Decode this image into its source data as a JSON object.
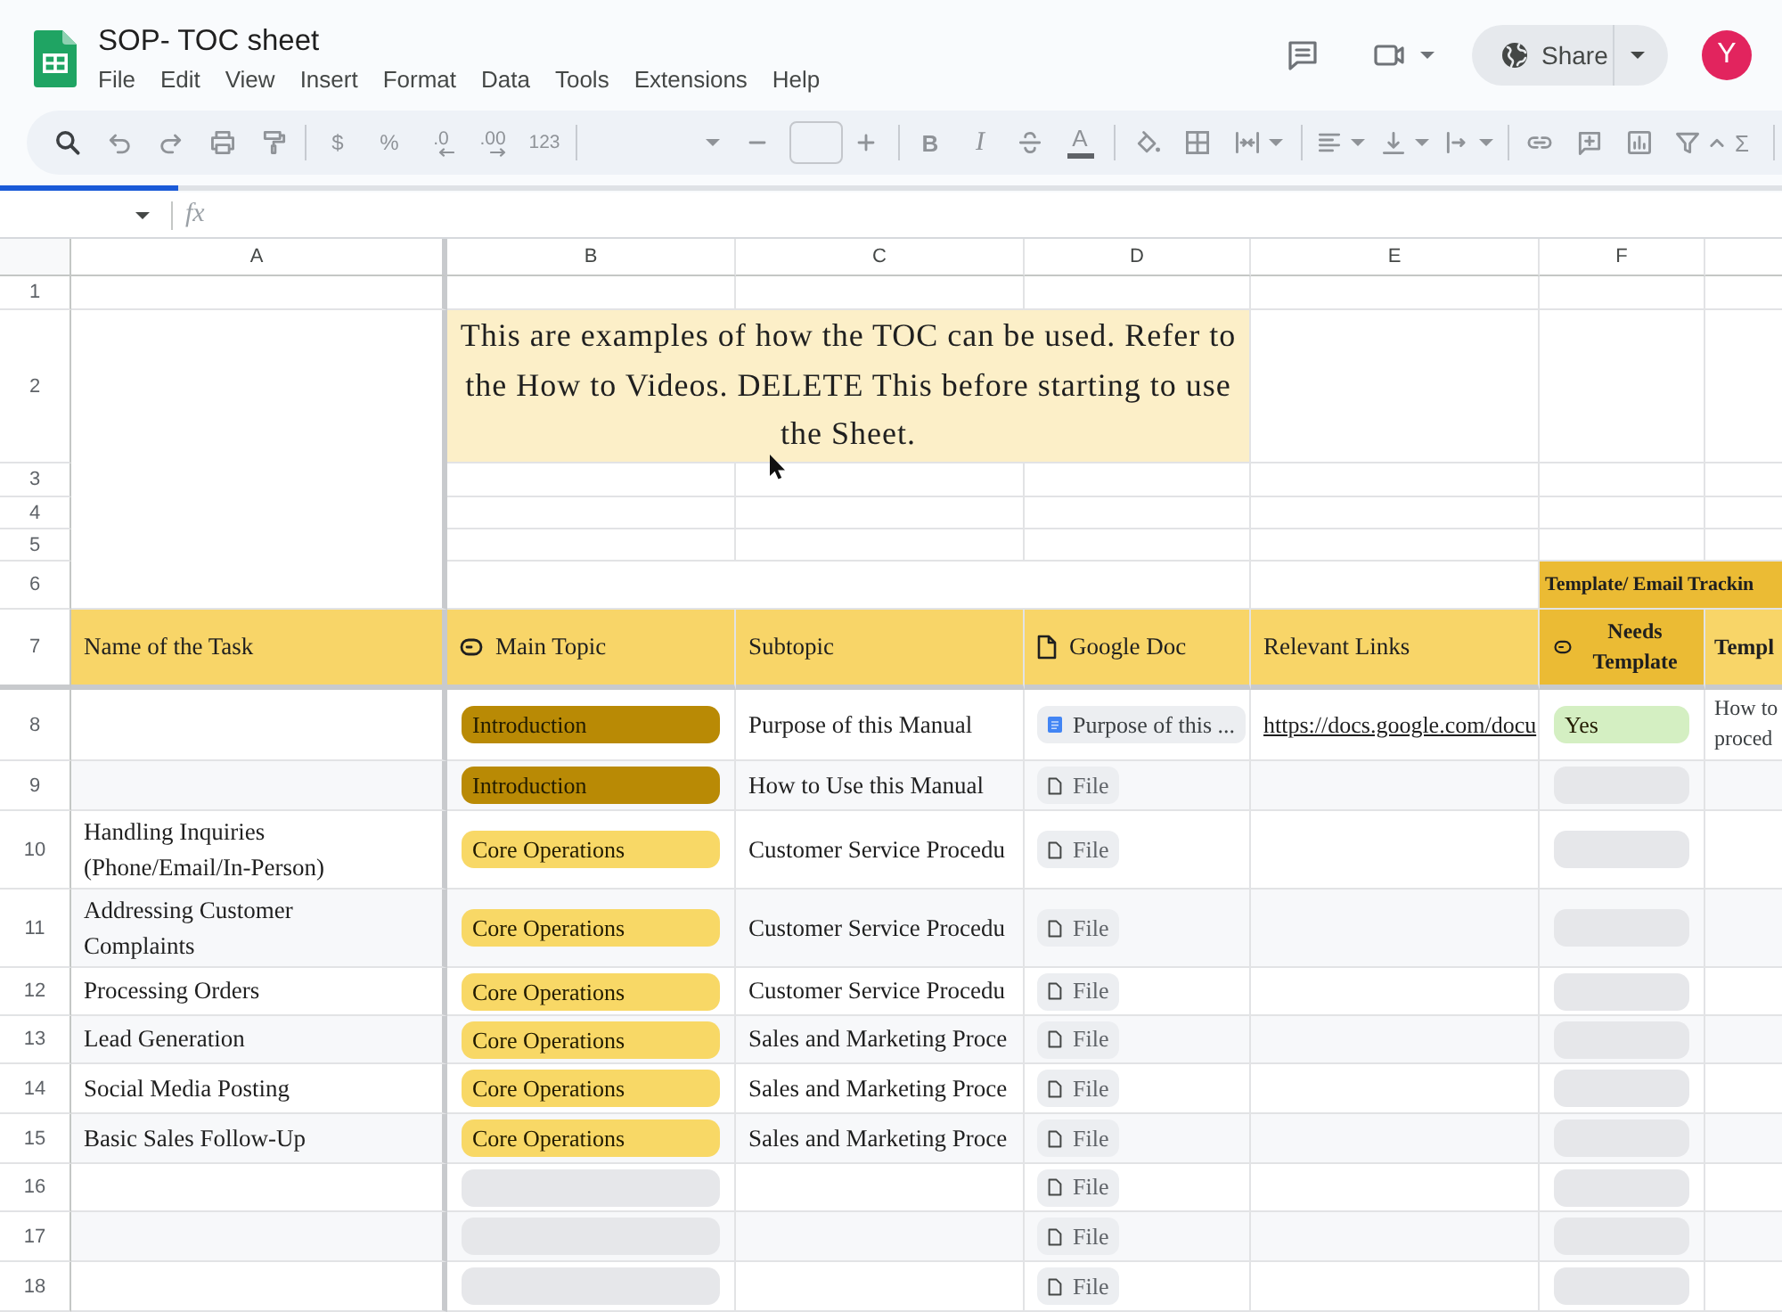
{
  "document": {
    "title": "SOP- TOC sheet"
  },
  "menu": [
    "File",
    "Edit",
    "View",
    "Insert",
    "Format",
    "Data",
    "Tools",
    "Extensions",
    "Help"
  ],
  "share": {
    "label": "Share"
  },
  "account": {
    "initial": "Y"
  },
  "toolbar": {
    "currency": "$",
    "percent": "%",
    "decrease_decimals": ".0",
    "increase_decimals": ".00",
    "number_format": "123",
    "bold": "B",
    "italic": "I",
    "text_color": "A",
    "functions": "Σ"
  },
  "loading": {
    "level": 0.1
  },
  "formula_bar": {
    "label": "fx"
  },
  "sheet": {
    "column_letters": [
      "A",
      "B",
      "C",
      "D",
      "E",
      "F"
    ],
    "frozen_row_numbers": [
      "1",
      "2",
      "3",
      "4",
      "5",
      "6",
      "7"
    ],
    "note": "This are examples of how the TOC can be used. Refer to the How to Videos. DELETE This before starting to use the Sheet.",
    "group_header": "Template/ Email Trackin",
    "columns": [
      {
        "label": "Name of the Task",
        "kind": "text"
      },
      {
        "label": "Main Topic",
        "kind": "chip"
      },
      {
        "label": "Subtopic",
        "kind": "text"
      },
      {
        "label": "Google Doc",
        "kind": "file"
      },
      {
        "label": "Relevant Links",
        "kind": "text"
      },
      {
        "label": "Needs Template",
        "kind": "chip"
      },
      {
        "label": "Templ",
        "kind": "text"
      }
    ],
    "rows": [
      {
        "number": "8",
        "main_topic": {
          "label": "Introduction",
          "color": "#b98a05"
        },
        "subtopic": "Purpose of this Manual",
        "google_doc": {
          "kind": "document",
          "label": "Purpose of this ..."
        },
        "relevant_link": "https://docs.google.com/docu",
        "needs_template": {
          "label": "Yes",
          "color": "#d4efc2"
        },
        "column_7": "How to proced"
      },
      {
        "number": "9",
        "main_topic": {
          "label": "Introduction",
          "color": "#b98a05"
        },
        "subtopic": "How to Use this Manual",
        "google_doc": {
          "kind": "file",
          "label": "File"
        },
        "needs_template": {
          "color": "#e6e7ea"
        }
      },
      {
        "number": "10",
        "task": "Handling Inquiries (Phone/Email/In-Person)",
        "main_topic": {
          "label": "Core Operations",
          "color": "#f8d866"
        },
        "subtopic": "Customer Service Procedu",
        "google_doc": {
          "kind": "file",
          "label": "File"
        },
        "needs_template": {
          "color": "#e6e7ea"
        }
      },
      {
        "number": "11",
        "task": "Addressing Customer Complaints",
        "main_topic": {
          "label": "Core Operations",
          "color": "#f8d866"
        },
        "subtopic": "Customer Service Procedu",
        "google_doc": {
          "kind": "file",
          "label": "File"
        },
        "needs_template": {
          "color": "#e6e7ea"
        }
      },
      {
        "number": "12",
        "task": "Processing Orders",
        "main_topic": {
          "label": "Core Operations",
          "color": "#f8d866"
        },
        "subtopic": "Customer Service Procedu",
        "google_doc": {
          "kind": "file",
          "label": "File"
        },
        "needs_template": {
          "color": "#e6e7ea"
        }
      },
      {
        "number": "13",
        "task": "Lead Generation",
        "main_topic": {
          "label": "Core Operations",
          "color": "#f8d866"
        },
        "subtopic": "Sales and Marketing Proce",
        "google_doc": {
          "kind": "file",
          "label": "File"
        },
        "needs_template": {
          "color": "#e6e7ea"
        }
      },
      {
        "number": "14",
        "task": "Social Media Posting",
        "main_topic": {
          "label": "Core Operations",
          "color": "#f8d866"
        },
        "subtopic": "Sales and Marketing Proce",
        "google_doc": {
          "kind": "file",
          "label": "File"
        },
        "needs_template": {
          "color": "#e6e7ea"
        }
      },
      {
        "number": "15",
        "task": "Basic Sales Follow-Up",
        "main_topic": {
          "label": "Core Operations",
          "color": "#f8d866"
        },
        "subtopic": "Sales and Marketing Proce",
        "google_doc": {
          "kind": "file",
          "label": "File"
        },
        "needs_template": {
          "color": "#e6e7ea"
        }
      },
      {
        "number": "16",
        "main_topic": {
          "color": "#e6e7ea"
        },
        "google_doc": {
          "kind": "file",
          "label": "File"
        },
        "needs_template": {
          "color": "#e6e7ea"
        }
      },
      {
        "number": "17",
        "main_topic": {
          "color": "#e6e7ea"
        },
        "google_doc": {
          "kind": "file",
          "label": "File"
        },
        "needs_template": {
          "color": "#e6e7ea"
        }
      },
      {
        "number": "18",
        "main_topic": {
          "color": "#e6e7ea"
        },
        "google_doc": {
          "kind": "file",
          "label": "File"
        },
        "needs_template": {
          "color": "#e6e7ea"
        }
      }
    ]
  }
}
